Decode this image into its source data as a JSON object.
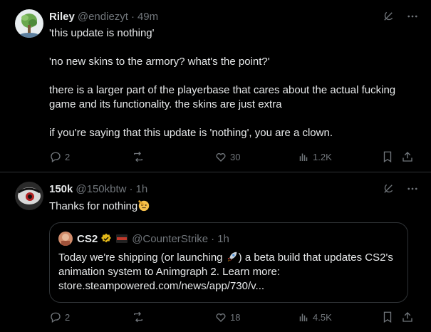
{
  "tweets": [
    {
      "author": {
        "name": "Riley",
        "handle": "@endiezyt",
        "dot": "·",
        "time": "49m"
      },
      "paragraphs": [
        "'this update is nothing'",
        "'no new skins to the armory? what's the point?'",
        "there is a larger part of the playerbase that cares about the actual fucking game and its functionality. the skins are just extra",
        "if you're saying that this update is 'nothing', you are a clown."
      ],
      "stats": {
        "replies": "2",
        "reposts": "",
        "likes": "30",
        "views": "1.2K"
      }
    },
    {
      "author": {
        "name": "150k",
        "handle": "@150kbtw",
        "dot": "·",
        "time": "1h"
      },
      "text": "Thanks for nothing",
      "quote": {
        "name": "CS2",
        "handle": "@CounterStrike",
        "dot": "·",
        "time": "1h",
        "text_part1": "Today we're shipping (or launching ",
        "text_part2": ") a beta build that updates CS2's animation system to Animgraph 2. Learn more: store.steampowered.com/news/app/730/v..."
      },
      "stats": {
        "replies": "2",
        "reposts": "",
        "likes": "18",
        "views": "4.5K"
      }
    }
  ],
  "colors": {
    "background": "#000000",
    "text": "#e7e9ea",
    "muted": "#71767b",
    "border": "#2f3336",
    "verified_gold": "#e2b719"
  },
  "icons": [
    "grok-icon",
    "more-icon",
    "reply-icon",
    "repost-icon",
    "like-icon",
    "views-icon",
    "bookmark-icon",
    "share-icon",
    "rocket-emoji",
    "salute-emoji",
    "verified-badge-icon",
    "flag-icon"
  ]
}
